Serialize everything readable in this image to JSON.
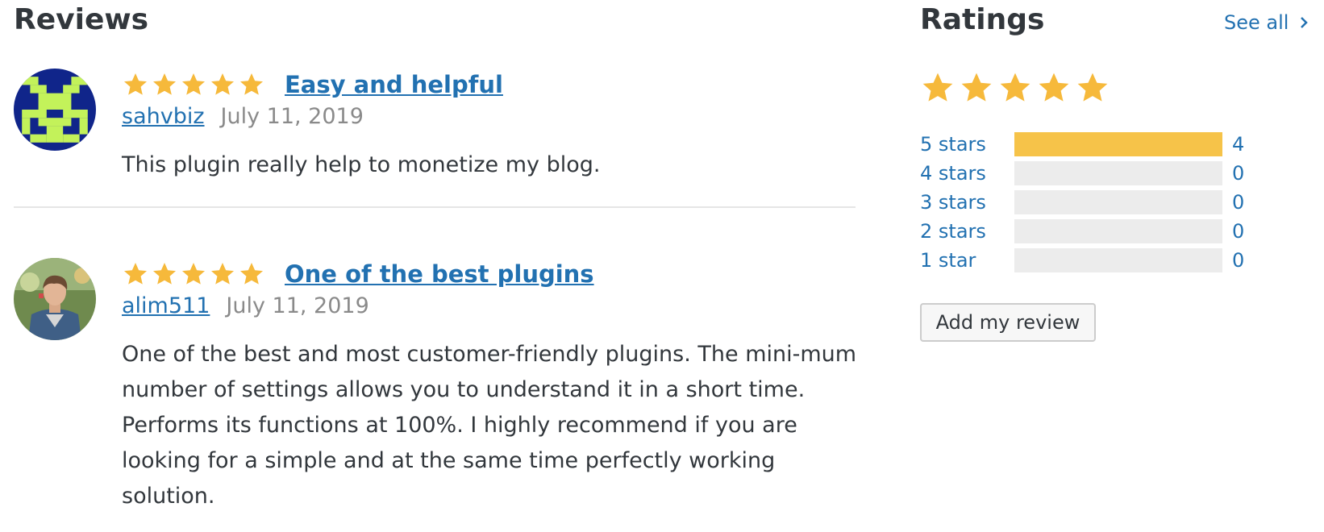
{
  "reviews": {
    "heading": "Reviews",
    "items": [
      {
        "rating": 5,
        "title": "Easy and helpful",
        "author": "sahvbiz",
        "date": "July 11, 2019",
        "body": "This plugin really help to monetize my blog.",
        "avatar": "pixel-identicon"
      },
      {
        "rating": 5,
        "title": "One of the best plugins",
        "author": "alim511",
        "date": "July 11, 2019",
        "body": "One of the best and most customer-friendly plugins. The mini-mum number of settings allows you to understand it in a short time. Performs its functions at 100%. I highly recommend if you are looking for a simple and at the same time perfectly working solution.",
        "avatar": "user-photo"
      }
    ]
  },
  "ratings": {
    "heading": "Ratings",
    "see_all": "See all",
    "overall_stars": 5,
    "breakdown": [
      {
        "label": "5 stars",
        "count": "4",
        "fraction": 1.0
      },
      {
        "label": "4 stars",
        "count": "0",
        "fraction": 0
      },
      {
        "label": "3 stars",
        "count": "0",
        "fraction": 0
      },
      {
        "label": "2 stars",
        "count": "0",
        "fraction": 0
      },
      {
        "label": "1 star",
        "count": "0",
        "fraction": 0
      }
    ],
    "add_review_label": "Add my review"
  },
  "colors": {
    "star": "#f6b93b",
    "link": "#2271b1",
    "bar_fill": "#f6c349",
    "bar_track": "#ececec",
    "identicon_bg": "#10258a",
    "identicon_fg": "#c3f25a"
  }
}
